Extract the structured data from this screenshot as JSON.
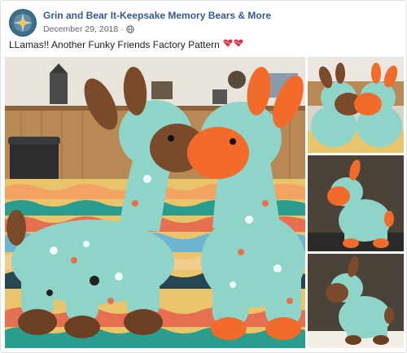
{
  "post": {
    "page_name": "Grin and Bear It-Keepsake Memory Bears & More",
    "date": "December 29, 2018",
    "separator": "·",
    "privacy_icon": "globe-icon",
    "text": "LLamas!! Another Funky Friends Factory Pattern",
    "emoji": [
      "heart-ribbon-icon",
      "heart-ribbon-icon"
    ],
    "colors": {
      "link": "#365899",
      "meta": "#616770",
      "heart": "#e0245e",
      "plush_teal": "#8fd4c8",
      "plush_orange": "#f26b2b",
      "plush_brown": "#7a4a2a"
    }
  },
  "photos": [
    {
      "name": "main-photo",
      "subject": "two llama plushies on striped blanket"
    },
    {
      "name": "thumb-top",
      "subject": "two llama plushies"
    },
    {
      "name": "thumb-middle",
      "subject": "orange-faced llama plushie"
    },
    {
      "name": "thumb-bottom",
      "subject": "brown-faced llama plushie"
    }
  ]
}
